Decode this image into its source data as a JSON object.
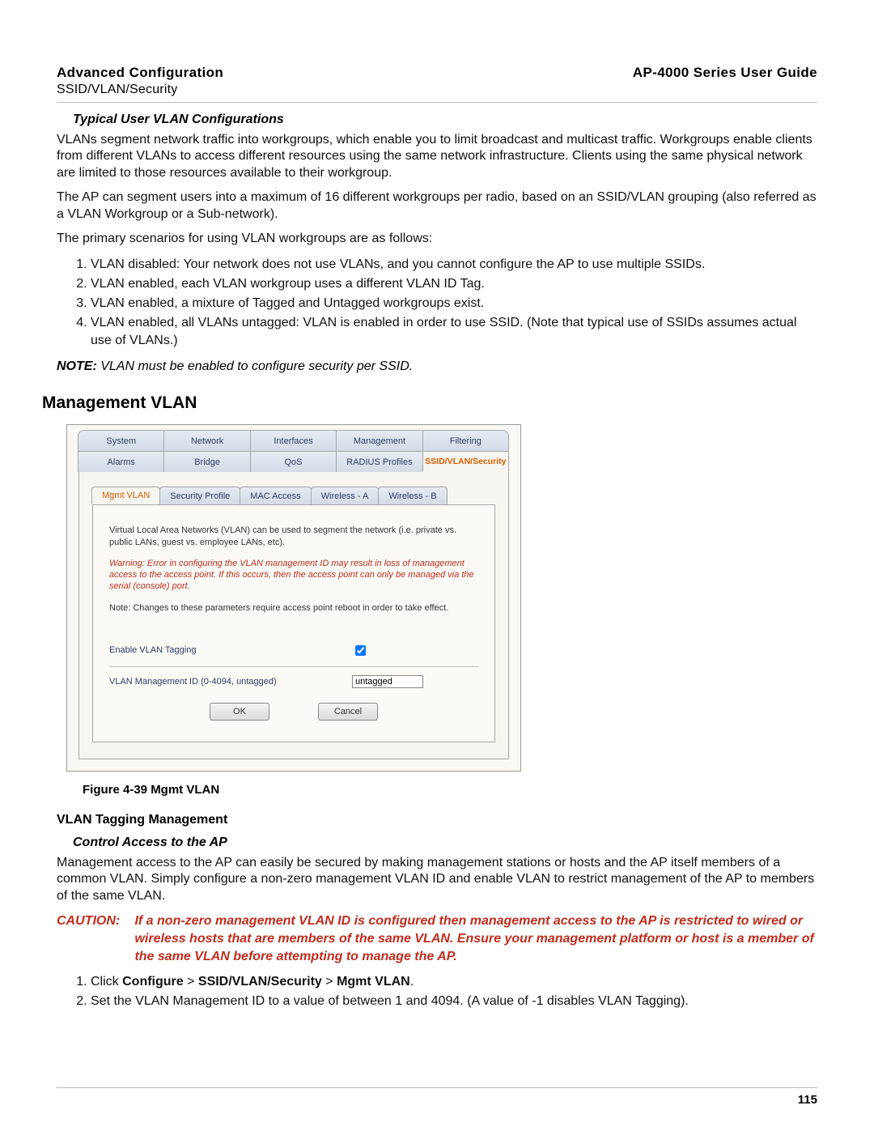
{
  "header": {
    "left_title": "Advanced Configuration",
    "right_title": "AP-4000 Series User Guide",
    "subtitle": "SSID/VLAN/Security"
  },
  "section1": {
    "heading": "Typical User VLAN Configurations",
    "p1": "VLANs segment network traffic into workgroups, which enable you to limit broadcast and multicast traffic. Workgroups enable clients from different VLANs to access different resources using the same network infrastructure. Clients using the same physical network are limited to those resources available to their workgroup.",
    "p2": "The AP can segment users into a maximum of 16 different workgroups per radio, based on an SSID/VLAN grouping (also referred as a VLAN Workgroup or a Sub-network).",
    "p3": "The primary scenarios for using VLAN workgroups are as follows:",
    "list": [
      "VLAN disabled: Your network does not use VLANs, and you cannot configure the AP to use multiple SSIDs.",
      "VLAN enabled, each VLAN workgroup uses a different VLAN ID Tag.",
      "VLAN enabled, a mixture of Tagged and Untagged workgroups exist.",
      "VLAN enabled, all VLANs untagged: VLAN is enabled in order to use SSID. (Note that typical use of SSIDs assumes actual use of VLANs.)"
    ],
    "note_label": "NOTE:",
    "note_text": "VLAN must be enabled to configure security per SSID."
  },
  "section2": {
    "heading": "Management VLAN"
  },
  "figure": {
    "tabs_top": [
      "System",
      "Network",
      "Interfaces",
      "Management",
      "Filtering"
    ],
    "tabs_bot": [
      "Alarms",
      "Bridge",
      "QoS",
      "RADIUS Profiles",
      "SSID/VLAN/Security"
    ],
    "subtabs": [
      "Mgmt VLAN",
      "Security Profile",
      "MAC Access",
      "Wireless - A",
      "Wireless - B"
    ],
    "intro": "Virtual Local Area Networks (VLAN) can be used to segment the network (i.e. private vs. public LANs, guest vs. employee LANs, etc).",
    "warning": "Warning: Error in configuring the VLAN management ID may result in loss of management access to the access point. If this occurs, then the access point can only be managed via the serial (console) port.",
    "note": "Note: Changes to these parameters require access point reboot in order to take effect.",
    "field1_label": "Enable VLAN Tagging",
    "field2_label": "VLAN Management ID (0-4094, untagged)",
    "field2_value": "untagged",
    "ok": "OK",
    "cancel": "Cancel",
    "caption": "Figure 4-39 Mgmt VLAN"
  },
  "section3": {
    "h4": "VLAN Tagging Management",
    "sub": "Control Access to the AP",
    "p1": "Management access to the AP can easily be secured by making management stations or hosts and the AP itself members of a common VLAN. Simply configure a non-zero management VLAN ID and enable VLAN to restrict management of the AP to members of the same VLAN.",
    "caution_label": "CAUTION:",
    "caution_text": "If a non-zero management VLAN ID is configured then management access to the AP is restricted to wired or wireless hosts that are members of the same VLAN. Ensure your management platform or host is a member of the same VLAN before attempting to manage the AP.",
    "step1_prefix": "Click ",
    "step1_b1": "Configure",
    "step1_sep": " > ",
    "step1_b2": "SSID/VLAN/Security",
    "step1_b3": "Mgmt VLAN",
    "step1_suffix": ".",
    "step2": "Set the VLAN Management ID to a value of between 1 and 4094. (A value of -1 disables VLAN Tagging)."
  },
  "page_number": "115"
}
